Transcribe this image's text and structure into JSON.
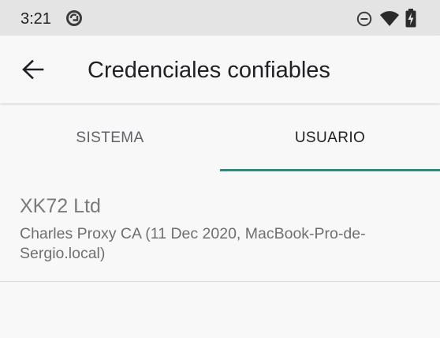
{
  "status_bar": {
    "time": "3:21",
    "icons": [
      "sync-badge-icon",
      "do-not-disturb-icon",
      "wifi-icon",
      "battery-charging-icon"
    ]
  },
  "app_bar": {
    "title": "Credenciales confiables",
    "back_icon": "arrow-back-icon"
  },
  "tabs": [
    {
      "label": "SISTEMA",
      "selected": false
    },
    {
      "label": "USUARIO",
      "selected": true
    }
  ],
  "colors": {
    "accent": "#2e8b7a",
    "status_bar_bg": "#e4e4e4",
    "surface": "#f8f8f8"
  },
  "credentials": [
    {
      "organization": "XK72 Ltd",
      "name": "Charles Proxy CA (11 Dec 2020, MacBook-Pro-de-Sergio.local)"
    }
  ]
}
